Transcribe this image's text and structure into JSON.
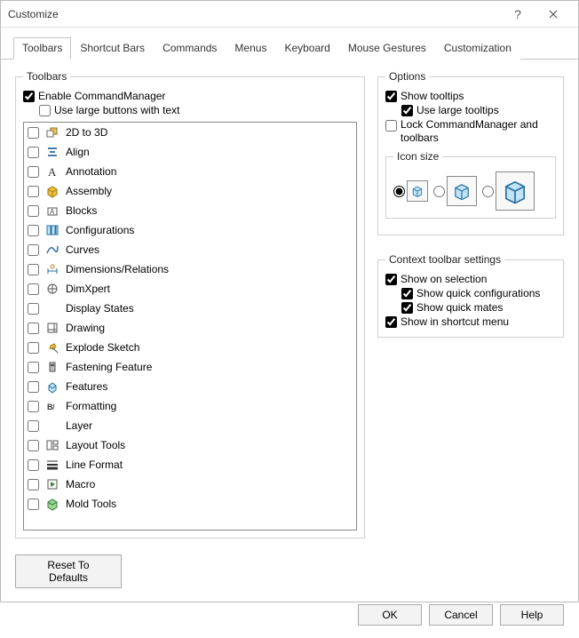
{
  "window": {
    "title": "Customize"
  },
  "tabs": [
    {
      "label": "Toolbars",
      "active": true
    },
    {
      "label": "Shortcut Bars"
    },
    {
      "label": "Commands"
    },
    {
      "label": "Menus"
    },
    {
      "label": "Keyboard"
    },
    {
      "label": "Mouse Gestures"
    },
    {
      "label": "Customization"
    }
  ],
  "toolbars_group": {
    "legend": "Toolbars",
    "enable_commandmanager": {
      "label": "Enable CommandManager",
      "checked": true
    },
    "use_large_buttons": {
      "label": "Use large buttons with text",
      "checked": false
    },
    "items": [
      {
        "label": "2D to 3D",
        "icon": "2d3d"
      },
      {
        "label": "Align",
        "icon": "align"
      },
      {
        "label": "Annotation",
        "icon": "annotation"
      },
      {
        "label": "Assembly",
        "icon": "assembly"
      },
      {
        "label": "Blocks",
        "icon": "blocks"
      },
      {
        "label": "Configurations",
        "icon": "configurations"
      },
      {
        "label": "Curves",
        "icon": "curves"
      },
      {
        "label": "Dimensions/Relations",
        "icon": "dimensions"
      },
      {
        "label": "DimXpert",
        "icon": "dimxpert"
      },
      {
        "label": "Display States",
        "icon": ""
      },
      {
        "label": "Drawing",
        "icon": "drawing"
      },
      {
        "label": "Explode Sketch",
        "icon": "explode"
      },
      {
        "label": "Fastening Feature",
        "icon": "fastening"
      },
      {
        "label": "Features",
        "icon": "features"
      },
      {
        "label": "Formatting",
        "icon": "formatting"
      },
      {
        "label": "Layer",
        "icon": ""
      },
      {
        "label": "Layout Tools",
        "icon": "layout"
      },
      {
        "label": "Line Format",
        "icon": "lineformat"
      },
      {
        "label": "Macro",
        "icon": "macro"
      },
      {
        "label": "Mold Tools",
        "icon": "mold"
      }
    ],
    "reset_label": "Reset To Defaults"
  },
  "options_group": {
    "legend": "Options",
    "show_tooltips": {
      "label": "Show tooltips",
      "checked": true
    },
    "use_large_tooltips": {
      "label": "Use large tooltips",
      "checked": true
    },
    "lock_cm": {
      "label": "Lock CommandManager and toolbars",
      "checked": false
    },
    "icon_size_legend": "Icon size",
    "icon_size_selected": 0
  },
  "context_group": {
    "legend": "Context toolbar settings",
    "show_on_selection": {
      "label": "Show on selection",
      "checked": true
    },
    "show_quick_config": {
      "label": "Show quick configurations",
      "checked": true
    },
    "show_quick_mates": {
      "label": "Show quick mates",
      "checked": true
    },
    "show_in_shortcut": {
      "label": "Show in shortcut menu",
      "checked": true
    }
  },
  "buttons": {
    "ok": "OK",
    "cancel": "Cancel",
    "help": "Help"
  }
}
